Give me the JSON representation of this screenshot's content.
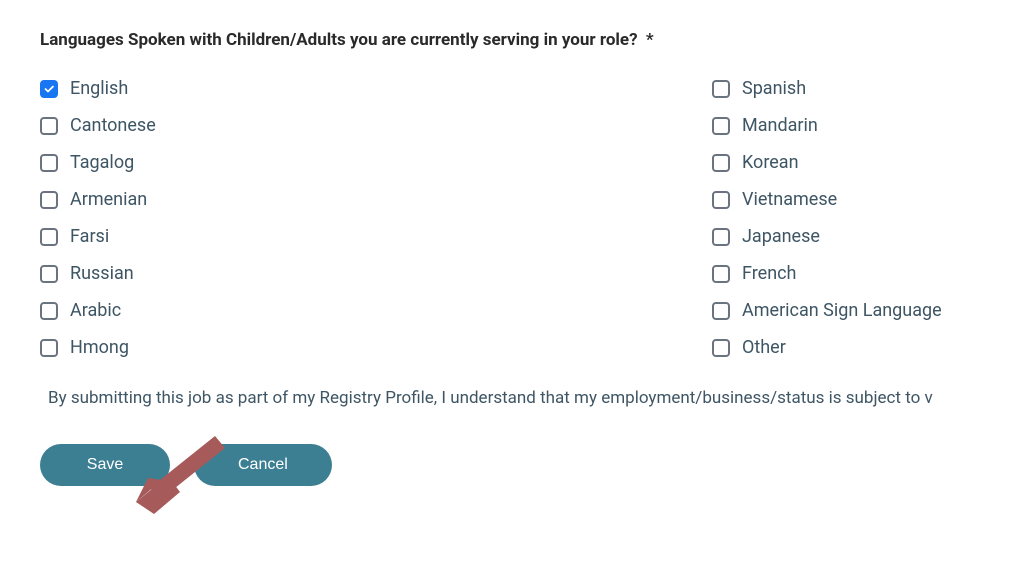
{
  "question": {
    "label": "Languages Spoken with Children/Adults you are currently serving in your role?",
    "required_marker": "*"
  },
  "languages": {
    "left": [
      {
        "label": "English",
        "checked": true
      },
      {
        "label": "Cantonese",
        "checked": false
      },
      {
        "label": "Tagalog",
        "checked": false
      },
      {
        "label": "Armenian",
        "checked": false
      },
      {
        "label": "Farsi",
        "checked": false
      },
      {
        "label": "Russian",
        "checked": false
      },
      {
        "label": "Arabic",
        "checked": false
      },
      {
        "label": "Hmong",
        "checked": false
      }
    ],
    "right": [
      {
        "label": "Spanish",
        "checked": false
      },
      {
        "label": "Mandarin",
        "checked": false
      },
      {
        "label": "Korean",
        "checked": false
      },
      {
        "label": "Vietnamese",
        "checked": false
      },
      {
        "label": "Japanese",
        "checked": false
      },
      {
        "label": "French",
        "checked": false
      },
      {
        "label": "American Sign Language",
        "checked": false
      },
      {
        "label": "Other",
        "checked": false
      }
    ]
  },
  "disclaimer": "By submitting this job as part of my Registry Profile, I understand that my employment/business/status is subject to v",
  "buttons": {
    "save": "Save",
    "cancel": "Cancel"
  },
  "colors": {
    "checkbox_checked": "#1976f2",
    "button_bg": "#3d7f92",
    "text_primary": "#3e5564",
    "arrow": "#a65a5a"
  }
}
